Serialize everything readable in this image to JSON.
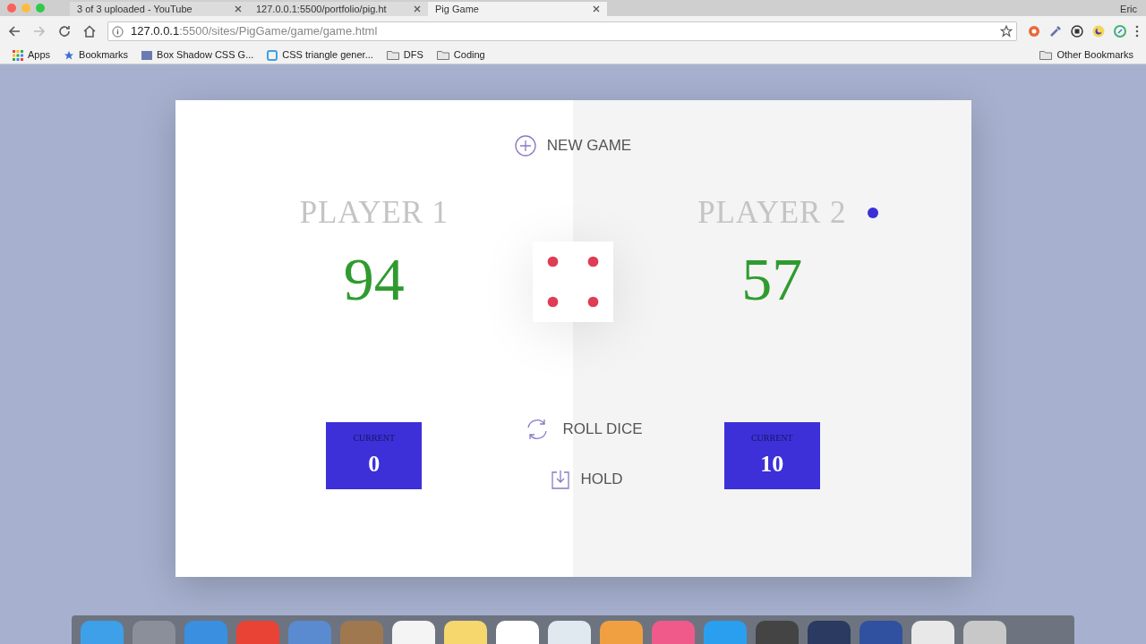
{
  "browser": {
    "tabs": [
      {
        "title": "3 of 3 uploaded - YouTube",
        "selected": false
      },
      {
        "title": "127.0.0.1:5500/portfolio/pig.ht",
        "selected": false
      },
      {
        "title": "Pig Game",
        "selected": true
      }
    ],
    "profile": "Eric",
    "address": {
      "host": "127.0.0.1",
      "path": ":5500/sites/PigGame/game/game.html"
    },
    "bookmarks": [
      {
        "label": "Apps",
        "kind": "apps"
      },
      {
        "label": "Bookmarks",
        "kind": "star"
      },
      {
        "label": "Box Shadow CSS G...",
        "kind": "page"
      },
      {
        "label": "CSS triangle gener...",
        "kind": "site"
      },
      {
        "label": "DFS",
        "kind": "folder"
      },
      {
        "label": "Coding",
        "kind": "folder"
      }
    ],
    "other_bookmarks": "Other Bookmarks"
  },
  "game": {
    "new_game": "NEW GAME",
    "players": [
      {
        "name": "PLAYER 1",
        "score": "94",
        "current_label": "CURRENT",
        "current": "0",
        "active": false
      },
      {
        "name": "PLAYER 2",
        "score": "57",
        "current_label": "CURRENT",
        "current": "10",
        "active": true
      }
    ],
    "roll": "ROLL DICE",
    "hold": "HOLD"
  }
}
